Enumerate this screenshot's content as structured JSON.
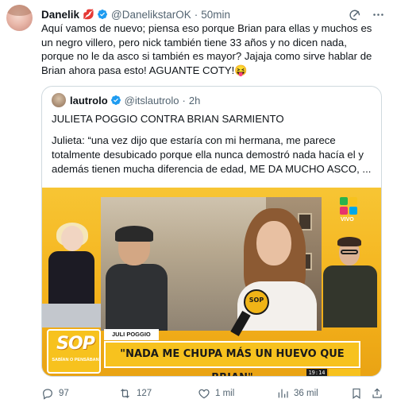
{
  "tweet": {
    "author": {
      "name": "Danelik",
      "badge_emoji": "💋",
      "handle": "@DanelikstarOK",
      "separator": "·",
      "time": "50min"
    },
    "text": "Aquí vamos de nuevo; piensa eso porque Brian para ellas y muchos es un negro villero, pero nick también tiene 33 años y no dicen nada, porque no le da asco si también es mayor? Jajaja como sirve hablar de Brian ahora pasa esto! AGUANTE COTY!😝",
    "icons": [
      "grok-icon",
      "more-icon"
    ]
  },
  "quoted": {
    "author": {
      "name": "lautrolo",
      "handle": "@itslautrolo",
      "separator": "·",
      "time": "2h"
    },
    "title": "JULIETA POGGIO CONTRA BRIAN SARMIENTO",
    "text": "Julieta: “una vez dijo que estaría con mi hermana, me parece totalmente desubicado porque ella nunca demostró nada hacía el y además tienen mucha diferencia de edad, ME DA MUCHO ASCO, ...",
    "media": {
      "mic_label": "SOP",
      "logo_colors": [
        "#2bb24c",
        "#f7c21e",
        "#e8336b",
        "#00a8e8"
      ],
      "live_label": "VIVO",
      "show_logo": "SOP",
      "show_subtitle": "SABÍAN O PENSÁBAN",
      "name_tag": "JULI POGGIO",
      "headline": "\"NADA ME CHUPA MÁS UN HUEVO QUE BRIAN\"",
      "clock": "19:14"
    }
  },
  "actions": {
    "replies": "97",
    "retweets": "127",
    "likes": "1 mil",
    "views": "36 mil"
  },
  "colors": {
    "text": "#0f1419",
    "secondary": "#536471",
    "verified": "#1d9bf0",
    "border": "#cfd9de",
    "show_yellow": "#f7c21e"
  }
}
